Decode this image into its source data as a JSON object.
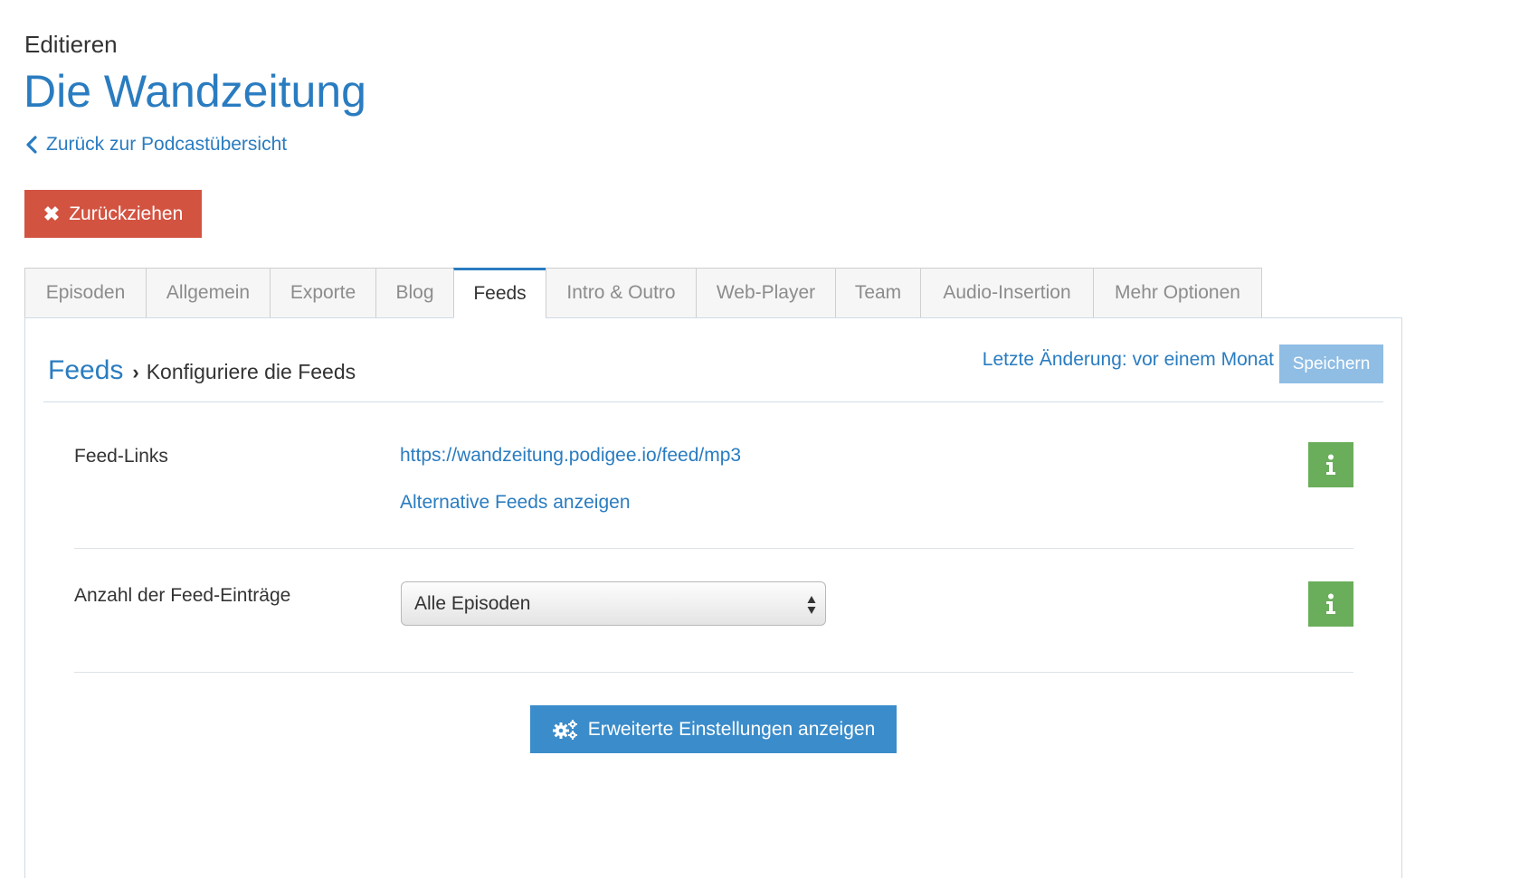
{
  "header": {
    "edit_label": "Editieren",
    "title": "Die Wandzeitung",
    "back_link": "Zurück zur Podcastübersicht",
    "retract_button": "Zurückziehen"
  },
  "tabs": [
    {
      "label": "Episoden",
      "active": false
    },
    {
      "label": "Allgemein",
      "active": false
    },
    {
      "label": "Exporte",
      "active": false
    },
    {
      "label": "Blog",
      "active": false
    },
    {
      "label": "Feeds",
      "active": true
    },
    {
      "label": "Intro & Outro",
      "active": false
    },
    {
      "label": "Web-Player",
      "active": false
    },
    {
      "label": "Team",
      "active": false
    },
    {
      "label": "Audio-Insertion",
      "active": false
    },
    {
      "label": "Mehr Optionen",
      "active": false
    }
  ],
  "panel": {
    "section": "Feeds",
    "subtitle": "Konfiguriere die Feeds",
    "last_change": "Letzte Änderung: vor einem Monat",
    "save_button": "Speichern"
  },
  "feed_links": {
    "label": "Feed-Links",
    "url": "https://wandzeitung.podigee.io/feed/mp3",
    "alternative": "Alternative Feeds anzeigen"
  },
  "feed_entries": {
    "label": "Anzahl der Feed-Einträge",
    "selected": "Alle Episoden"
  },
  "advanced_button": "Erweiterte Einstellungen anzeigen",
  "colors": {
    "accent": "#2a7cc0",
    "danger": "#d35341",
    "info": "#6aae5b",
    "save": "#8fbde4",
    "primary": "#3b8cca"
  }
}
